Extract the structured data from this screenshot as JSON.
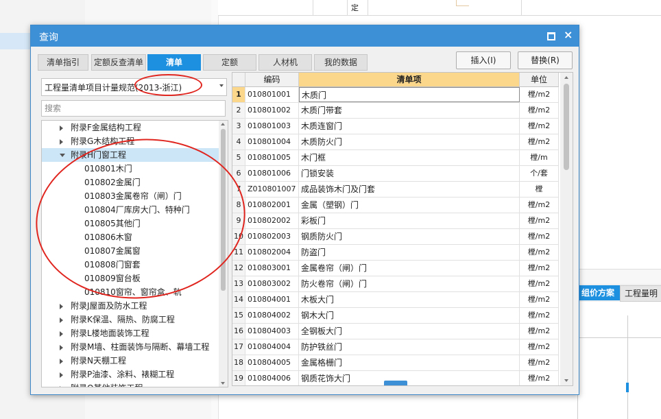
{
  "background": {
    "top_cell_text": "定",
    "bottom_tabs": [
      "组价方案",
      "工程量明"
    ]
  },
  "dialog": {
    "title": "查询",
    "tabs": [
      "清单指引",
      "定额反查清单",
      "清单",
      "定额",
      "人材机",
      "我的数据"
    ],
    "active_tab_index": 2,
    "buttons": {
      "insert": "插入(I)",
      "replace": "替换(R)"
    },
    "combo_value": "工程量清单项目计量规范(2013-浙江)",
    "search_placeholder": "搜索",
    "tree": [
      {
        "label": "附录F金属结构工程",
        "expandable": true,
        "expanded": false,
        "level": 0
      },
      {
        "label": "附录G木结构工程",
        "expandable": true,
        "expanded": false,
        "level": 0
      },
      {
        "label": "附录H门窗工程",
        "expandable": true,
        "expanded": true,
        "level": 0,
        "selected": true
      },
      {
        "label": "010801木门",
        "level": 1
      },
      {
        "label": "010802金属门",
        "level": 1
      },
      {
        "label": "010803金属卷帘（闸）门",
        "level": 1
      },
      {
        "label": "010804厂库房大门、特种门",
        "level": 1
      },
      {
        "label": "010805其他门",
        "level": 1
      },
      {
        "label": "010806木窗",
        "level": 1
      },
      {
        "label": "010807金属窗",
        "level": 1
      },
      {
        "label": "010808门窗套",
        "level": 1
      },
      {
        "label": "010809窗台板",
        "level": 1
      },
      {
        "label": "010810窗帘、窗帘盒、轨",
        "level": 1
      },
      {
        "label": "附录J屋面及防水工程",
        "expandable": true,
        "expanded": false,
        "level": 0
      },
      {
        "label": "附录K保温、隔热、防腐工程",
        "expandable": true,
        "expanded": false,
        "level": 0
      },
      {
        "label": "附录L楼地面装饰工程",
        "expandable": true,
        "expanded": false,
        "level": 0
      },
      {
        "label": "附录M墙、柱面装饰与隔断、幕墙工程",
        "expandable": true,
        "expanded": false,
        "level": 0
      },
      {
        "label": "附录N天棚工程",
        "expandable": true,
        "expanded": false,
        "level": 0
      },
      {
        "label": "附录P油漆、涂料、裱糊工程",
        "expandable": true,
        "expanded": false,
        "level": 0
      },
      {
        "label": "附录Q其他装饰工程",
        "expandable": true,
        "expanded": false,
        "level": 0
      }
    ],
    "grid": {
      "headers": [
        "",
        "编码",
        "清单项",
        "单位"
      ],
      "rows": [
        [
          "1",
          "010801001",
          "木质门",
          "樘/m2"
        ],
        [
          "2",
          "010801002",
          "木质门带套",
          "樘/m2"
        ],
        [
          "3",
          "010801003",
          "木质连窗门",
          "樘/m2"
        ],
        [
          "4",
          "010801004",
          "木质防火门",
          "樘/m2"
        ],
        [
          "5",
          "010801005",
          "木门框",
          "樘/m"
        ],
        [
          "6",
          "010801006",
          "门锁安装",
          "个/套"
        ],
        [
          "7",
          "Z010801007",
          "成品装饰木门及门套",
          "樘"
        ],
        [
          "8",
          "010802001",
          "金属（塑钢）门",
          "樘/m2"
        ],
        [
          "9",
          "010802002",
          "彩板门",
          "樘/m2"
        ],
        [
          "10",
          "010802003",
          "钢质防火门",
          "樘/m2"
        ],
        [
          "11",
          "010802004",
          "防盗门",
          "樘/m2"
        ],
        [
          "12",
          "010803001",
          "金属卷帘（闸）门",
          "樘/m2"
        ],
        [
          "13",
          "010803002",
          "防火卷帘（闸）门",
          "樘/m2"
        ],
        [
          "14",
          "010804001",
          "木板大门",
          "樘/m2"
        ],
        [
          "15",
          "010804002",
          "钢木大门",
          "樘/m2"
        ],
        [
          "16",
          "010804003",
          "全钢板大门",
          "樘/m2"
        ],
        [
          "17",
          "010804004",
          "防护铁丝门",
          "樘/m2"
        ],
        [
          "18",
          "010804005",
          "金属格栅门",
          "樘/m2"
        ],
        [
          "19",
          "010804006",
          "钢质花饰大门",
          "樘/m2"
        ]
      ],
      "current_row_index": 0
    }
  },
  "colors": {
    "accent": "#1e90e0",
    "title_bar": "#3d8fd6",
    "header_highlight": "#fbd78c",
    "annotation": "#e0251f"
  }
}
